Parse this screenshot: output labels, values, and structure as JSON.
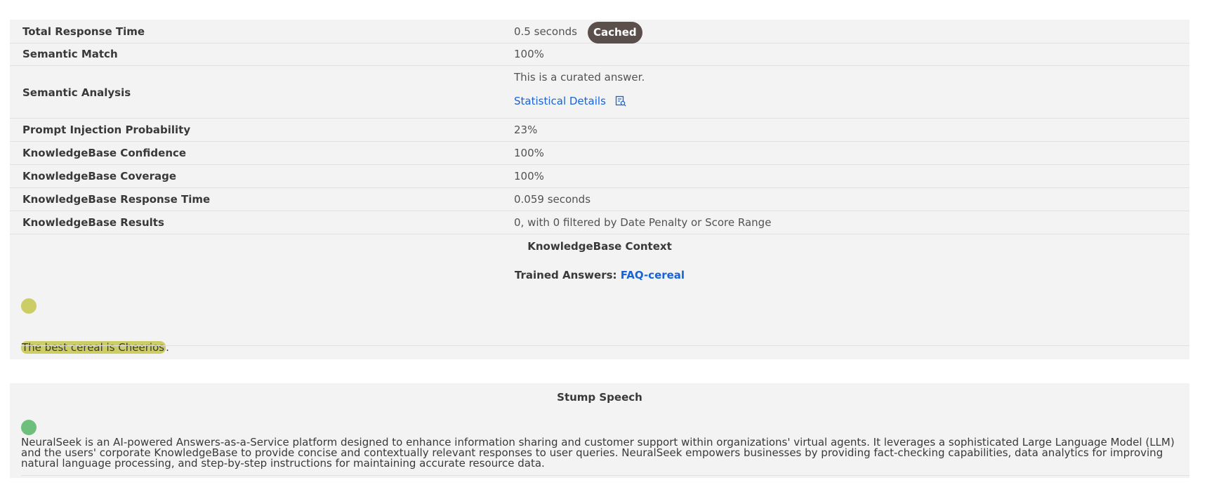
{
  "metrics": {
    "total_response_time": {
      "label": "Total Response Time",
      "value": "0.5 seconds",
      "badge": "Cached"
    },
    "semantic_match": {
      "label": "Semantic Match",
      "value": "100%"
    },
    "semantic_analysis": {
      "label": "Semantic Analysis",
      "value": "This is a curated answer.",
      "link": "Statistical Details"
    },
    "prompt_injection": {
      "label": "Prompt Injection Probability",
      "value": "23%"
    },
    "kb_confidence": {
      "label": "KnowledgeBase Confidence",
      "value": "100%"
    },
    "kb_coverage": {
      "label": "KnowledgeBase Coverage",
      "value": "100%"
    },
    "kb_response_time": {
      "label": "KnowledgeBase Response Time",
      "value": "0.059 seconds"
    },
    "kb_results": {
      "label": "KnowledgeBase Results",
      "value": "0, with 0 filtered by Date Penalty or Score Range"
    }
  },
  "kb_context": {
    "title": "KnowledgeBase Context",
    "trained_label": "Trained Answers:",
    "trained_link": "FAQ-cereal",
    "highlight_text": "The best cereal is Cheerios",
    "highlight_suffix": ".",
    "highlight_color": "#cdcd65"
  },
  "stump_speech": {
    "title": "Stump Speech",
    "text": "NeuralSeek is an AI-powered Answers-as-a-Service platform designed to enhance information sharing and customer support within organizations' virtual agents. It leverages a sophisticated Large Language Model (LLM) and the users' corporate KnowledgeBase to provide concise and contextually relevant responses to user queries. NeuralSeek empowers businesses by providing fact-checking capabilities, data analytics for improving natural language processing, and step-by-step instructions for maintaining accurate resource data.",
    "dot_color": "#6dbf7b"
  },
  "colors": {
    "panel_bg": "#f3f3f3",
    "link": "#1863d6",
    "badge_bg": "#5a4f4b",
    "context_dot": "#cdcd65",
    "stump_dot": "#6dbf7b"
  },
  "icons": {
    "statistical_details": "document-search-icon"
  }
}
